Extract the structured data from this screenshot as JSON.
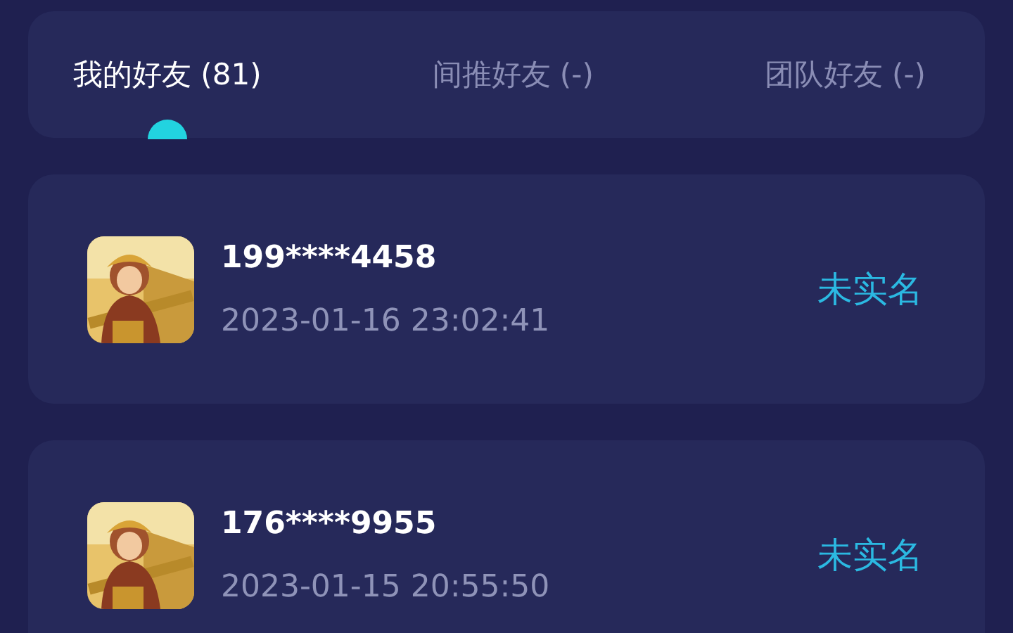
{
  "tabs": [
    {
      "label": "我的好友 (81)",
      "selected": true
    },
    {
      "label": "间推好友 (-)",
      "selected": false
    },
    {
      "label": "团队好友 (-)",
      "selected": false
    }
  ],
  "friends": [
    {
      "phone": "199****4458",
      "time": "2023-01-16 23:02:41",
      "status": "未实名"
    },
    {
      "phone": "176****9955",
      "time": "2023-01-15 20:55:50",
      "status": "未实名"
    }
  ]
}
